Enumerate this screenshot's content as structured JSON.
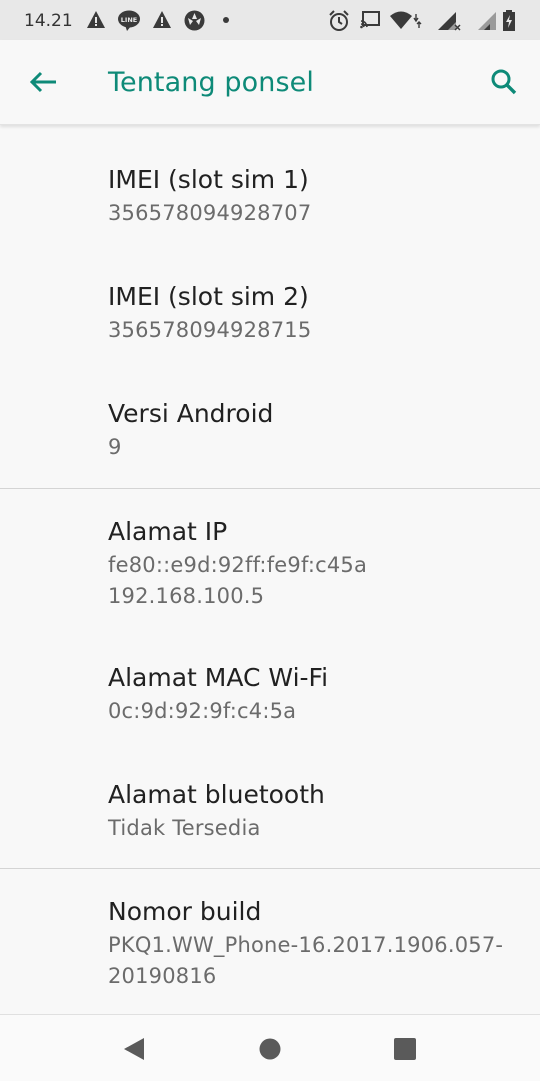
{
  "status_bar": {
    "time": "14.21",
    "left_icons": [
      "warning-icon",
      "line-app-icon",
      "warning-icon",
      "shutter-icon",
      "dot-icon"
    ],
    "right_icons": [
      "alarm-icon",
      "cast-icon",
      "wifi-icon",
      "signal-icon",
      "signal-icon",
      "battery-icon"
    ]
  },
  "app_bar": {
    "title": "Tentang ponsel",
    "accent_color": "#0e8a78"
  },
  "items": [
    {
      "title": "IMEI (slot sim 1)",
      "value": "356578094928707"
    },
    {
      "title": "IMEI (slot sim 2)",
      "value": "356578094928715"
    },
    {
      "title": "Versi Android",
      "value": "9"
    },
    {
      "title": "Alamat IP",
      "value": "fe80::e9d:92ff:fe9f:c45a",
      "value2": "192.168.100.5"
    },
    {
      "title": "Alamat MAC Wi-Fi",
      "value": "0c:9d:92:9f:c4:5a"
    },
    {
      "title": "Alamat bluetooth",
      "value": "Tidak Tersedia"
    },
    {
      "title": "Nomor build",
      "value": "PKQ1.WW_Phone-16.2017.1906.057-",
      "value2": "20190816"
    }
  ],
  "nav_bar": {
    "icons": [
      "back-triangle-icon",
      "home-circle-icon",
      "recents-square-icon"
    ]
  }
}
